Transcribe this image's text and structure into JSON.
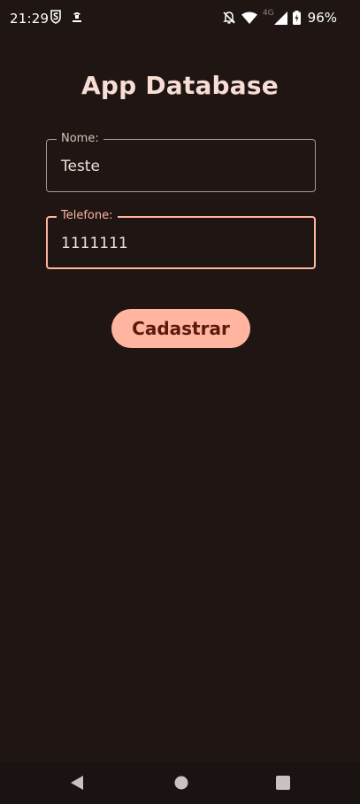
{
  "status_bar": {
    "time": "21:29",
    "network_type": "4G",
    "battery": "96%"
  },
  "app": {
    "title": "App Database"
  },
  "form": {
    "name_field": {
      "label": "Nome:",
      "value": "Teste"
    },
    "phone_field": {
      "label": "Telefone:",
      "value": "1111111"
    },
    "submit_label": "Cadastrar"
  },
  "colors": {
    "background": "#1f1614",
    "accent": "#ffb5a0",
    "title": "#f7ddd3",
    "button_text": "#5a1a0c"
  },
  "icons": {
    "status_left": [
      "s-shield-icon",
      "app-notification-icon"
    ],
    "status_right": [
      "notifications-off-icon",
      "wifi-icon",
      "cell-signal-icon",
      "battery-charging-icon"
    ],
    "nav": [
      "back-icon",
      "home-icon",
      "recents-icon"
    ]
  }
}
